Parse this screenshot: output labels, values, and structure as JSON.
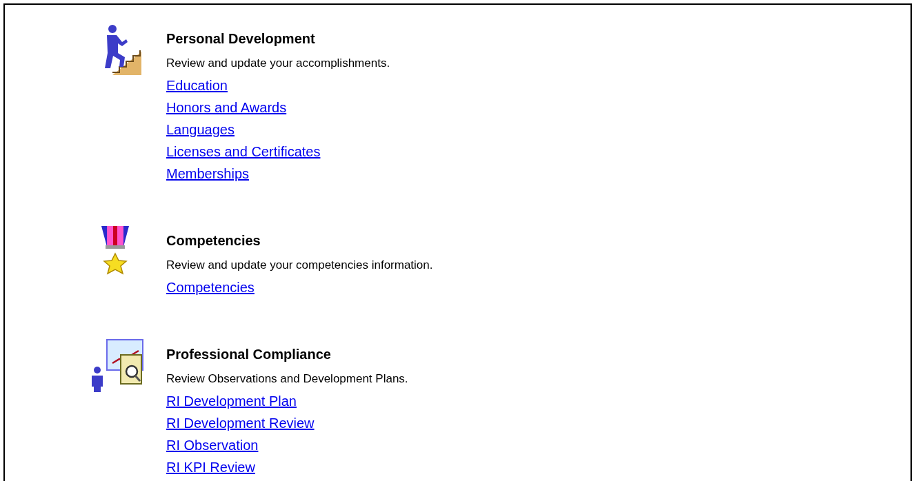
{
  "sections": [
    {
      "kind": "stairs",
      "title": "Personal Development",
      "description": "Review and update your accomplishments.",
      "links": [
        "Education",
        "Honors and Awards",
        "Languages",
        "Licenses and Certificates",
        "Memberships"
      ]
    },
    {
      "kind": "medal",
      "title": "Competencies",
      "description": "Review and update your competencies information.",
      "links": [
        "Competencies"
      ]
    },
    {
      "kind": "chart",
      "title": "Professional Compliance",
      "description": "Review Observations and Development Plans.",
      "links": [
        "RI Development Plan",
        "RI Development Review",
        "RI Observation",
        "RI KPI Review"
      ]
    }
  ]
}
